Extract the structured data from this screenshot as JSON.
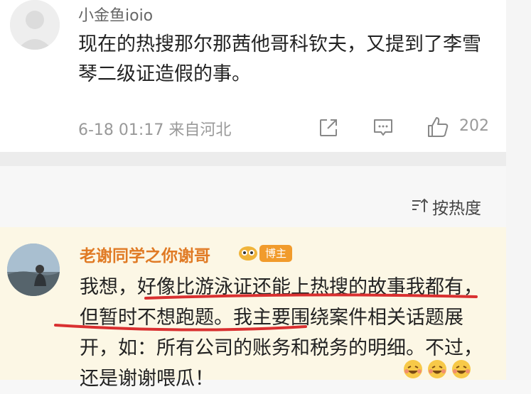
{
  "comment1": {
    "username": "小金鱼ioio",
    "text": "现在的热搜那尔那茜他哥科钦夫，又提到了李雪琴二级证造假的事。",
    "meta": "6-18 01:17  来自河北",
    "like_count": "202",
    "icons": [
      "share-icon",
      "comment-icon",
      "like-icon"
    ]
  },
  "sort": {
    "label": "按热度",
    "icon": "sort-icon"
  },
  "comment2": {
    "username": "老谢同学之你谢哥",
    "badge": "博主",
    "text": "我想，好像比游泳证还能上热搜的故事我都有，但暂时不想跑题。我主要围绕案件相关话题展开，如：所有公司的账务和税务的明细。不过，还是谢谢喂瓜！",
    "emojis": [
      "laughing-emoji",
      "laughing-emoji",
      "laughing-emoji"
    ]
  },
  "colors": {
    "author_name": "#e07a24",
    "badge": "#f19b2c",
    "underline": "#d93030",
    "highlight_bg": "#fcf7e5"
  }
}
